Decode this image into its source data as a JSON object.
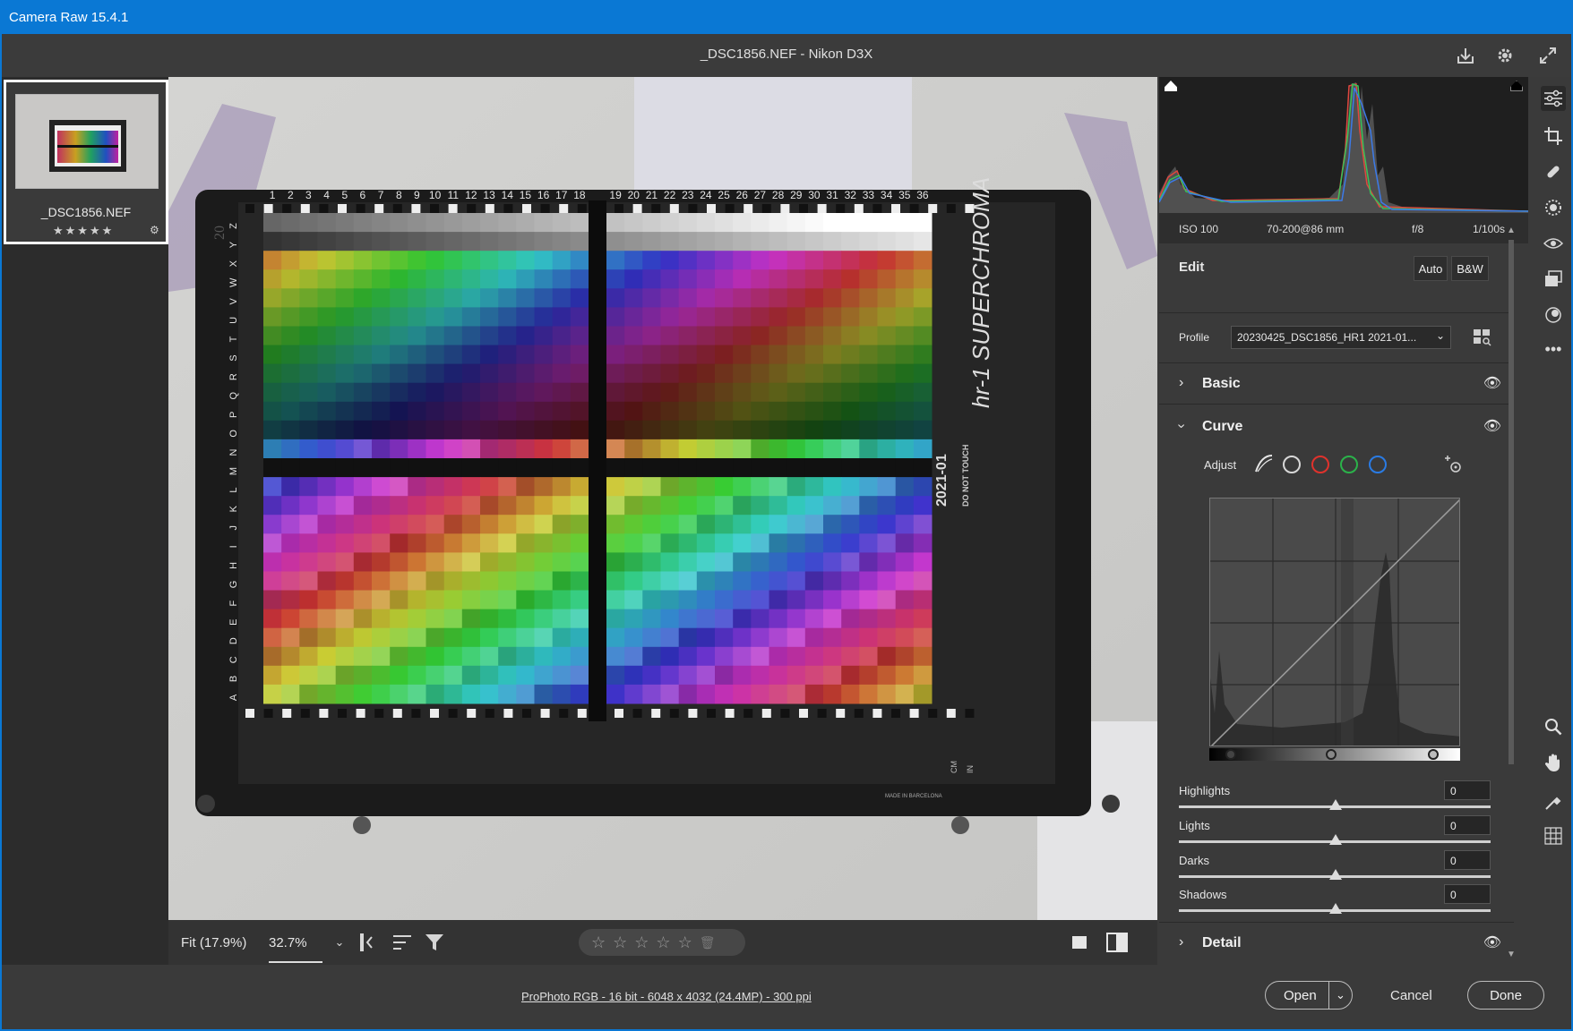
{
  "window": {
    "title": "Camera Raw 15.4.1"
  },
  "header": {
    "file_title": "_DSC1856.NEF  -  Nikon D3X"
  },
  "filmstrip": {
    "items": [
      {
        "name": "_DSC1856.NEF",
        "rating": 0
      }
    ]
  },
  "image_toolbar": {
    "fit_label": "Fit (17.9%)",
    "zoom_value": "32.7%"
  },
  "histogram": {
    "colors": {
      "red": "#e0473f",
      "green": "#38c25a",
      "blue": "#3c7ae8"
    }
  },
  "exif": {
    "iso": "ISO 100",
    "lens": "70-200@86 mm",
    "aperture": "f/8",
    "shutter": "1/100s"
  },
  "edit": {
    "title": "Edit",
    "auto_label": "Auto",
    "bw_label": "B&W"
  },
  "profile": {
    "label": "Profile",
    "value": "20230425_DSC1856_HR1 2021-01..."
  },
  "sections": {
    "basic": "Basic",
    "curve": "Curve",
    "detail": "Detail"
  },
  "curve": {
    "adjust_label": "Adjust",
    "sliders": [
      {
        "label": "Highlights",
        "value": "0"
      },
      {
        "label": "Lights",
        "value": "0"
      },
      {
        "label": "Darks",
        "value": "0"
      },
      {
        "label": "Shadows",
        "value": "0"
      }
    ]
  },
  "status": {
    "info": "ProPhoto RGB - 16 bit - 6048 x 4032 (24.4MP) - 300 ppi",
    "open_label": "Open",
    "cancel_label": "Cancel",
    "done_label": "Done"
  },
  "chart_card": {
    "column_numbers": [
      "1",
      "2",
      "3",
      "4",
      "5",
      "6",
      "7",
      "8",
      "9",
      "10",
      "11",
      "12",
      "13",
      "14",
      "15",
      "16",
      "17",
      "18",
      "19",
      "20",
      "21",
      "22",
      "23",
      "24",
      "25",
      "26",
      "27",
      "28",
      "29",
      "30",
      "31",
      "32",
      "33",
      "34",
      "35",
      "36"
    ],
    "row_letters": [
      "Z",
      "Y",
      "X",
      "W",
      "V",
      "U",
      "T",
      "S",
      "R",
      "Q",
      "P",
      "O",
      "N",
      "M",
      "L",
      "K",
      "J",
      "I",
      "H",
      "G",
      "F",
      "E",
      "D",
      "C",
      "B",
      "A"
    ],
    "brand": "hr-1 SUPERCHROMA",
    "year": "2021-01",
    "warning": "DO NOT TOUCH",
    "corner_mark": "20",
    "made_in": "MADE IN BARCELONA",
    "ruler_units": [
      "CM",
      "IN"
    ]
  },
  "accent_color": "#0a78d4"
}
